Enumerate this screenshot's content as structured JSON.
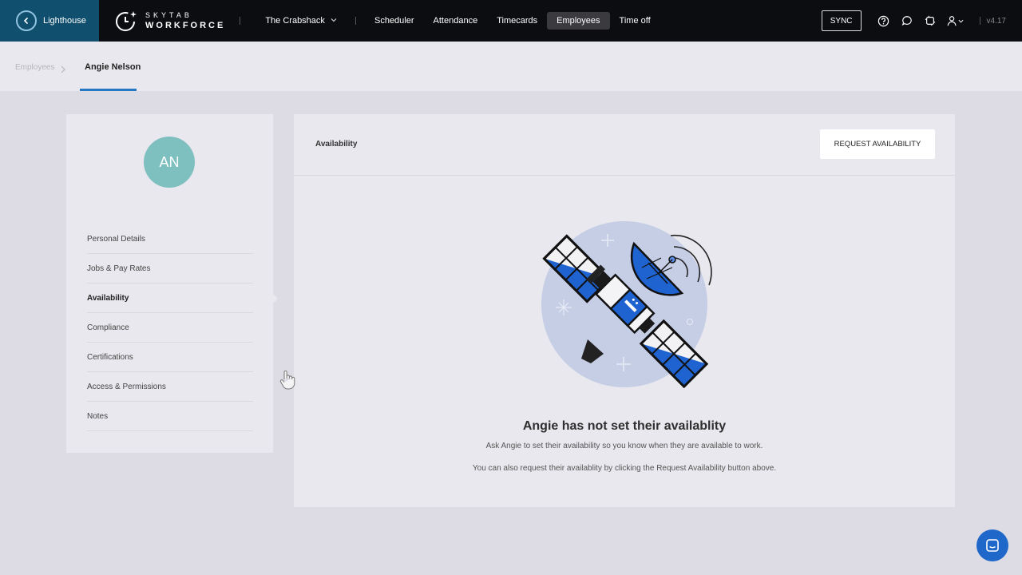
{
  "topbar": {
    "back_label": "Lighthouse",
    "brand_line1": "SKYTAB",
    "brand_line2": "WORKFORCE",
    "location": "The Crabshack",
    "nav": [
      {
        "label": "Scheduler"
      },
      {
        "label": "Attendance"
      },
      {
        "label": "Timecards"
      },
      {
        "label": "Employees",
        "active": true
      },
      {
        "label": "Time off"
      }
    ],
    "sync_label": "SYNC",
    "version": "v4.17",
    "icons": [
      "chevron-left-icon",
      "help-icon",
      "chat-bubble-icon",
      "refresh-icon",
      "user-icon",
      "chevron-down-icon"
    ]
  },
  "breadcrumb": {
    "parent": "Employees",
    "current": "Angie Nelson"
  },
  "profile": {
    "initials": "AN",
    "avatar_color": "#7ebfc0",
    "menu": [
      {
        "label": "Personal Details"
      },
      {
        "label": "Jobs & Pay Rates"
      },
      {
        "label": "Availability",
        "active": true
      },
      {
        "label": "Compliance"
      },
      {
        "label": "Certifications"
      },
      {
        "label": "Access & Permissions"
      },
      {
        "label": "Notes"
      }
    ]
  },
  "availability": {
    "title": "Availability",
    "request_button": "REQUEST AVAILABILITY",
    "empty_title": "Angie has not set their availablity",
    "empty_line1": "Ask Angie to set their availability so you know when they are available to work.",
    "empty_line2": "You can also request their availablity by clicking the Request Availability button above."
  },
  "colors": {
    "topbar": "#0c0d10",
    "back_block": "#104f6e",
    "accent": "#2478c4",
    "chat_button": "#1f68c9"
  }
}
